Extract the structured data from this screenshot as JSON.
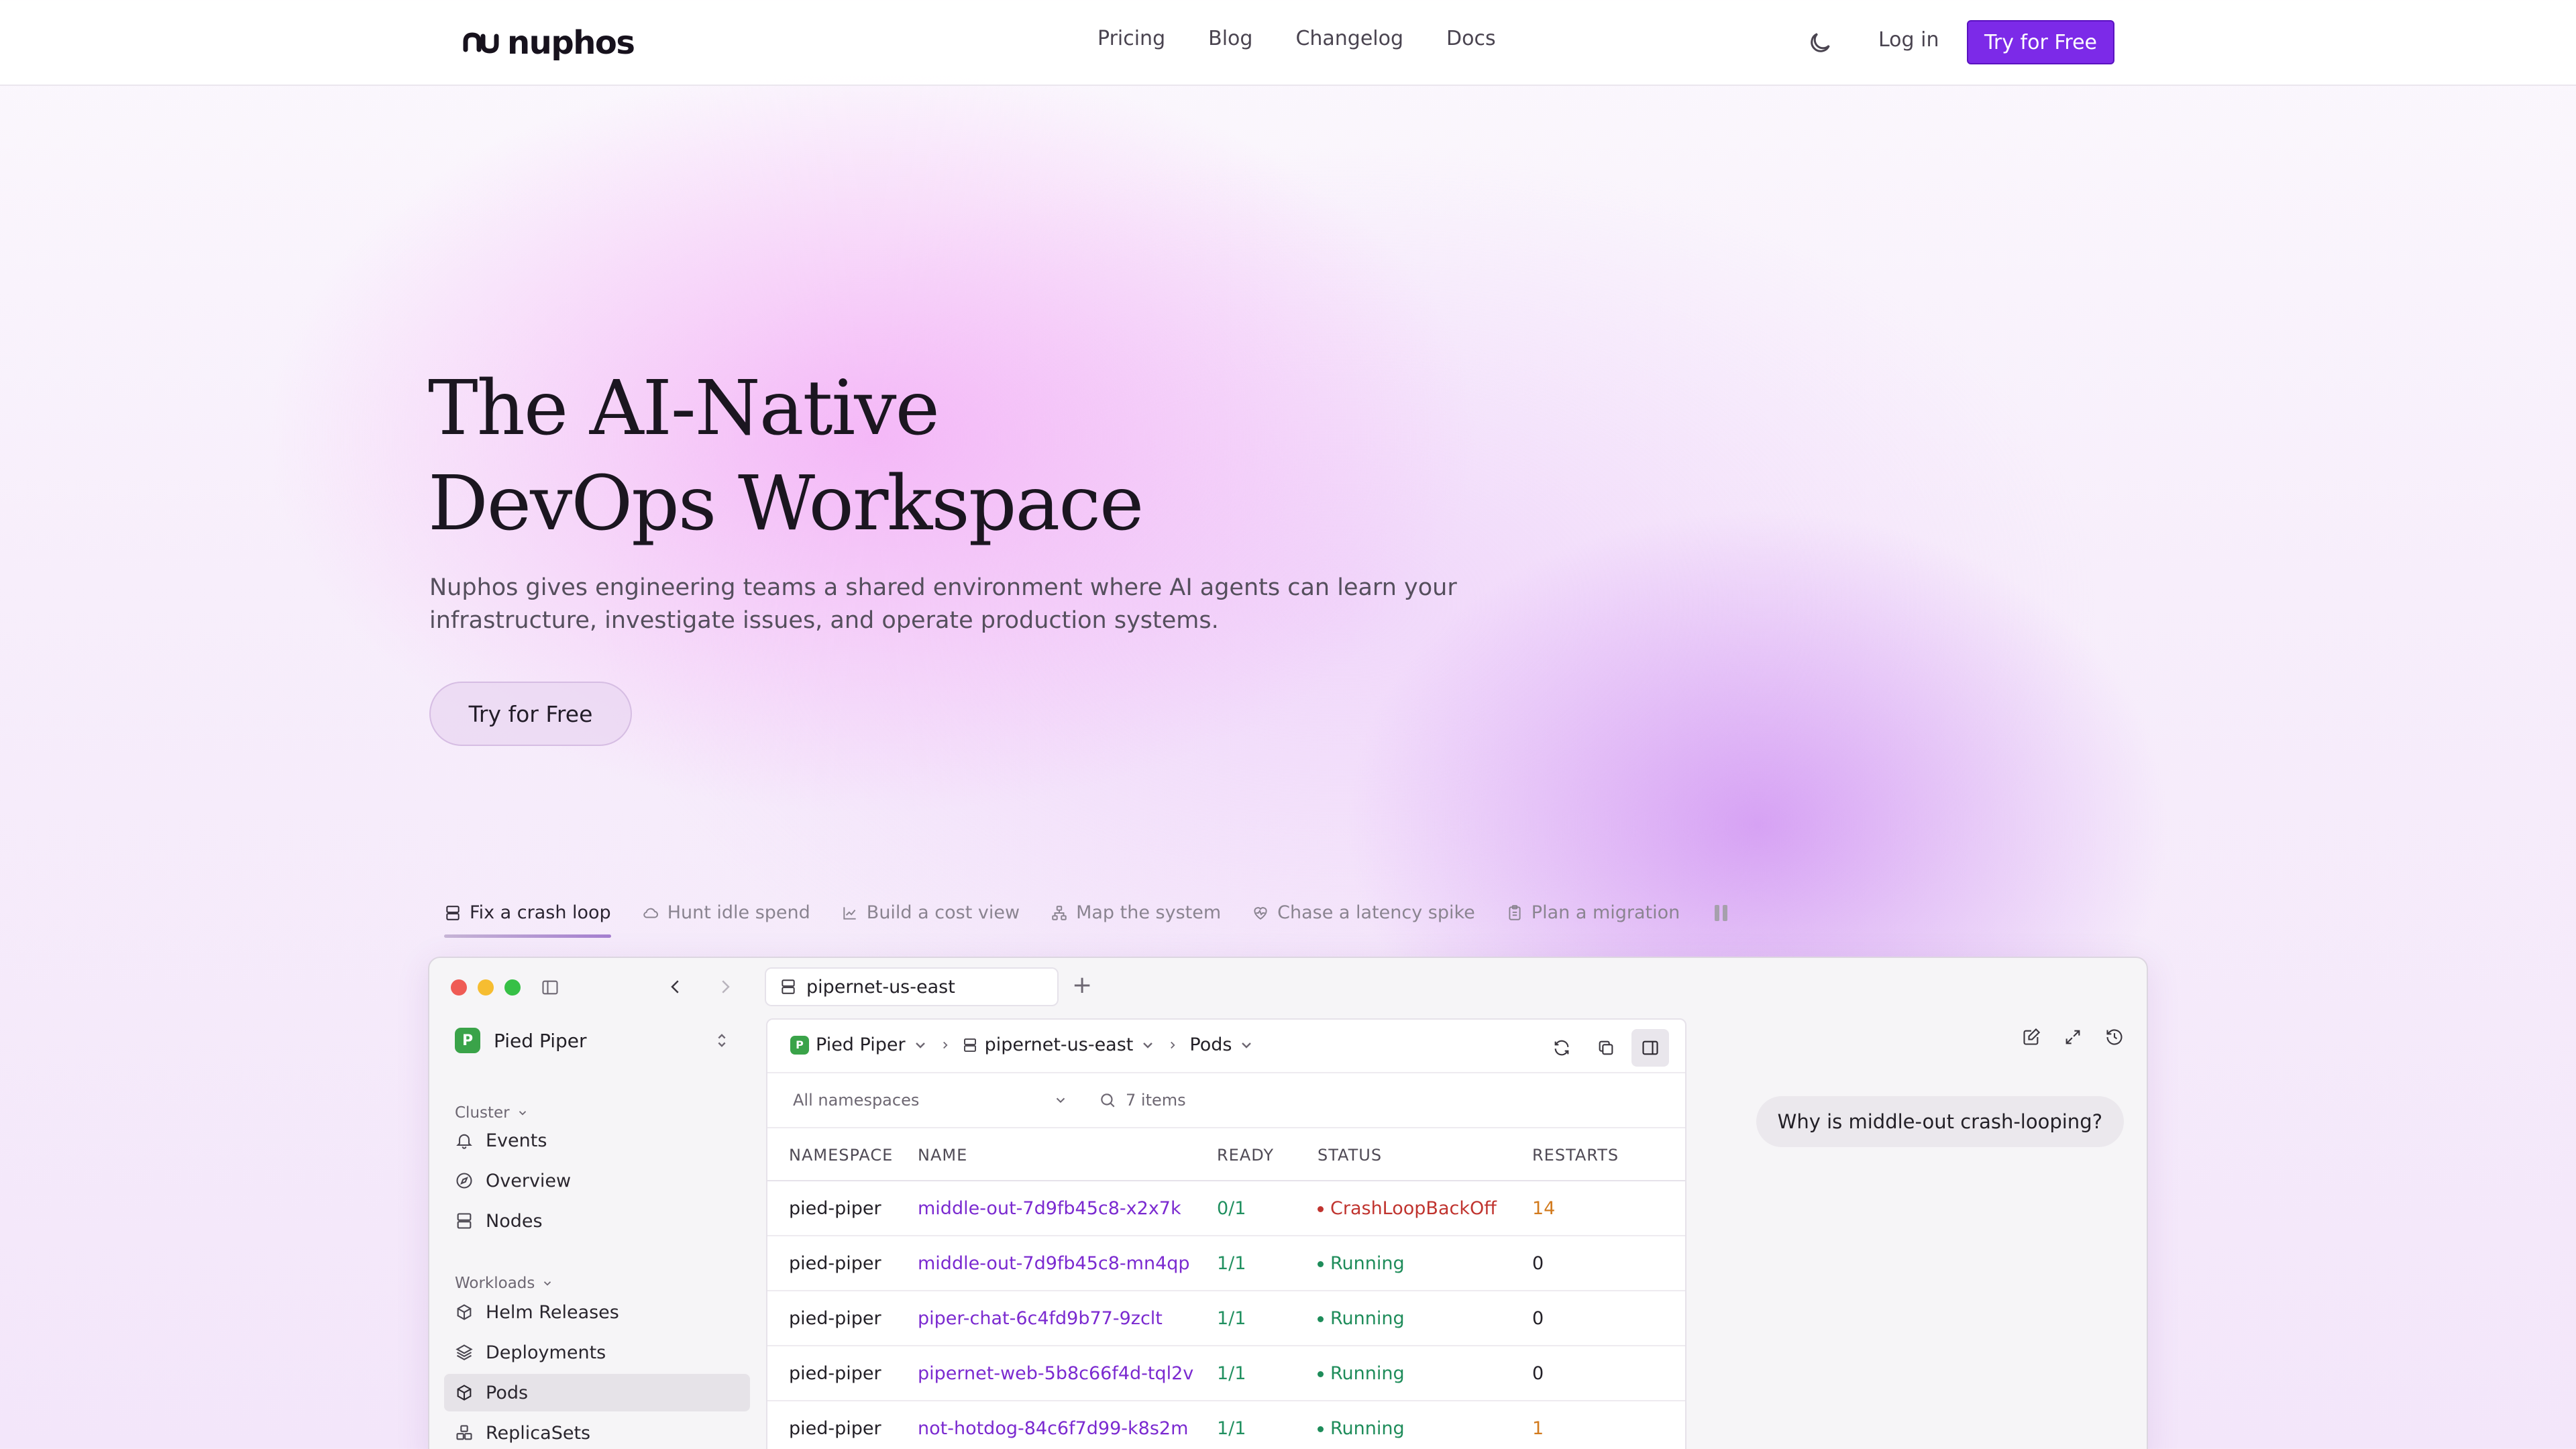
{
  "nav": {
    "brand": "nuphos",
    "links": [
      "Pricing",
      "Blog",
      "Changelog",
      "Docs"
    ],
    "login": "Log in",
    "cta": "Try for Free"
  },
  "hero": {
    "title_line1": "The AI-Native",
    "title_line2": "DevOps Workspace",
    "subtitle": "Nuphos gives engineering teams a shared environment where AI agents can learn your infrastructure, investigate issues, and operate production systems.",
    "cta": "Try for Free"
  },
  "scenarios": [
    {
      "label": "Fix a crash loop",
      "icon": "server-stack-icon",
      "active": true
    },
    {
      "label": "Hunt idle spend",
      "icon": "cloud-icon",
      "active": false
    },
    {
      "label": "Build a cost view",
      "icon": "line-chart-icon",
      "active": false
    },
    {
      "label": "Map the system",
      "icon": "network-icon",
      "active": false
    },
    {
      "label": "Chase a latency spike",
      "icon": "heart-pulse-icon",
      "active": false
    },
    {
      "label": "Plan a migration",
      "icon": "clipboard-icon",
      "active": false
    }
  ],
  "window": {
    "tab_label": "pipernet-us-east",
    "sidebar": {
      "org": "Pied Piper",
      "org_initial": "P",
      "sections": [
        {
          "label": "Cluster",
          "items": [
            {
              "label": "Events",
              "icon": "bell-icon"
            },
            {
              "label": "Overview",
              "icon": "compass-icon"
            },
            {
              "label": "Nodes",
              "icon": "server-icon"
            }
          ]
        },
        {
          "label": "Workloads",
          "items": [
            {
              "label": "Helm Releases",
              "icon": "package-icon"
            },
            {
              "label": "Deployments",
              "icon": "layers-icon"
            },
            {
              "label": "Pods",
              "icon": "cube-icon",
              "active": true
            },
            {
              "label": "ReplicaSets",
              "icon": "boxes-icon"
            }
          ]
        }
      ]
    },
    "breadcrumbs": [
      "Pied Piper",
      "pipernet-us-east",
      "Pods"
    ],
    "namespace_filter": "All namespaces",
    "items_count": "7 items",
    "table": {
      "headers": [
        "NAMESPACE",
        "NAME",
        "READY",
        "STATUS",
        "RESTARTS"
      ],
      "rows": [
        {
          "namespace": "pied-piper",
          "name": "middle-out-7d9fb45c8-x2x7k",
          "ready": "0/1",
          "status": "CrashLoopBackOff",
          "restarts": "14",
          "state": "crash"
        },
        {
          "namespace": "pied-piper",
          "name": "middle-out-7d9fb45c8-mn4qp",
          "ready": "1/1",
          "status": "Running",
          "restarts": "0",
          "state": "run"
        },
        {
          "namespace": "pied-piper",
          "name": "piper-chat-6c4fd9b77-9zclt",
          "ready": "1/1",
          "status": "Running",
          "restarts": "0",
          "state": "run"
        },
        {
          "namespace": "pied-piper",
          "name": "pipernet-web-5b8c66f4d-tql2v",
          "ready": "1/1",
          "status": "Running",
          "restarts": "0",
          "state": "run"
        },
        {
          "namespace": "pied-piper",
          "name": "not-hotdog-84c6f7d99-k8s2m",
          "ready": "1/1",
          "status": "Running",
          "restarts": "1",
          "state": "run"
        }
      ]
    },
    "chat": {
      "message": "Why is middle-out crash-looping?"
    }
  },
  "colors": {
    "accent": "#7c2ae8",
    "running": "#1e8c5a",
    "crash": "#c0342f",
    "restart_warn": "#d27a1d",
    "org_badge": "#3aa349"
  }
}
